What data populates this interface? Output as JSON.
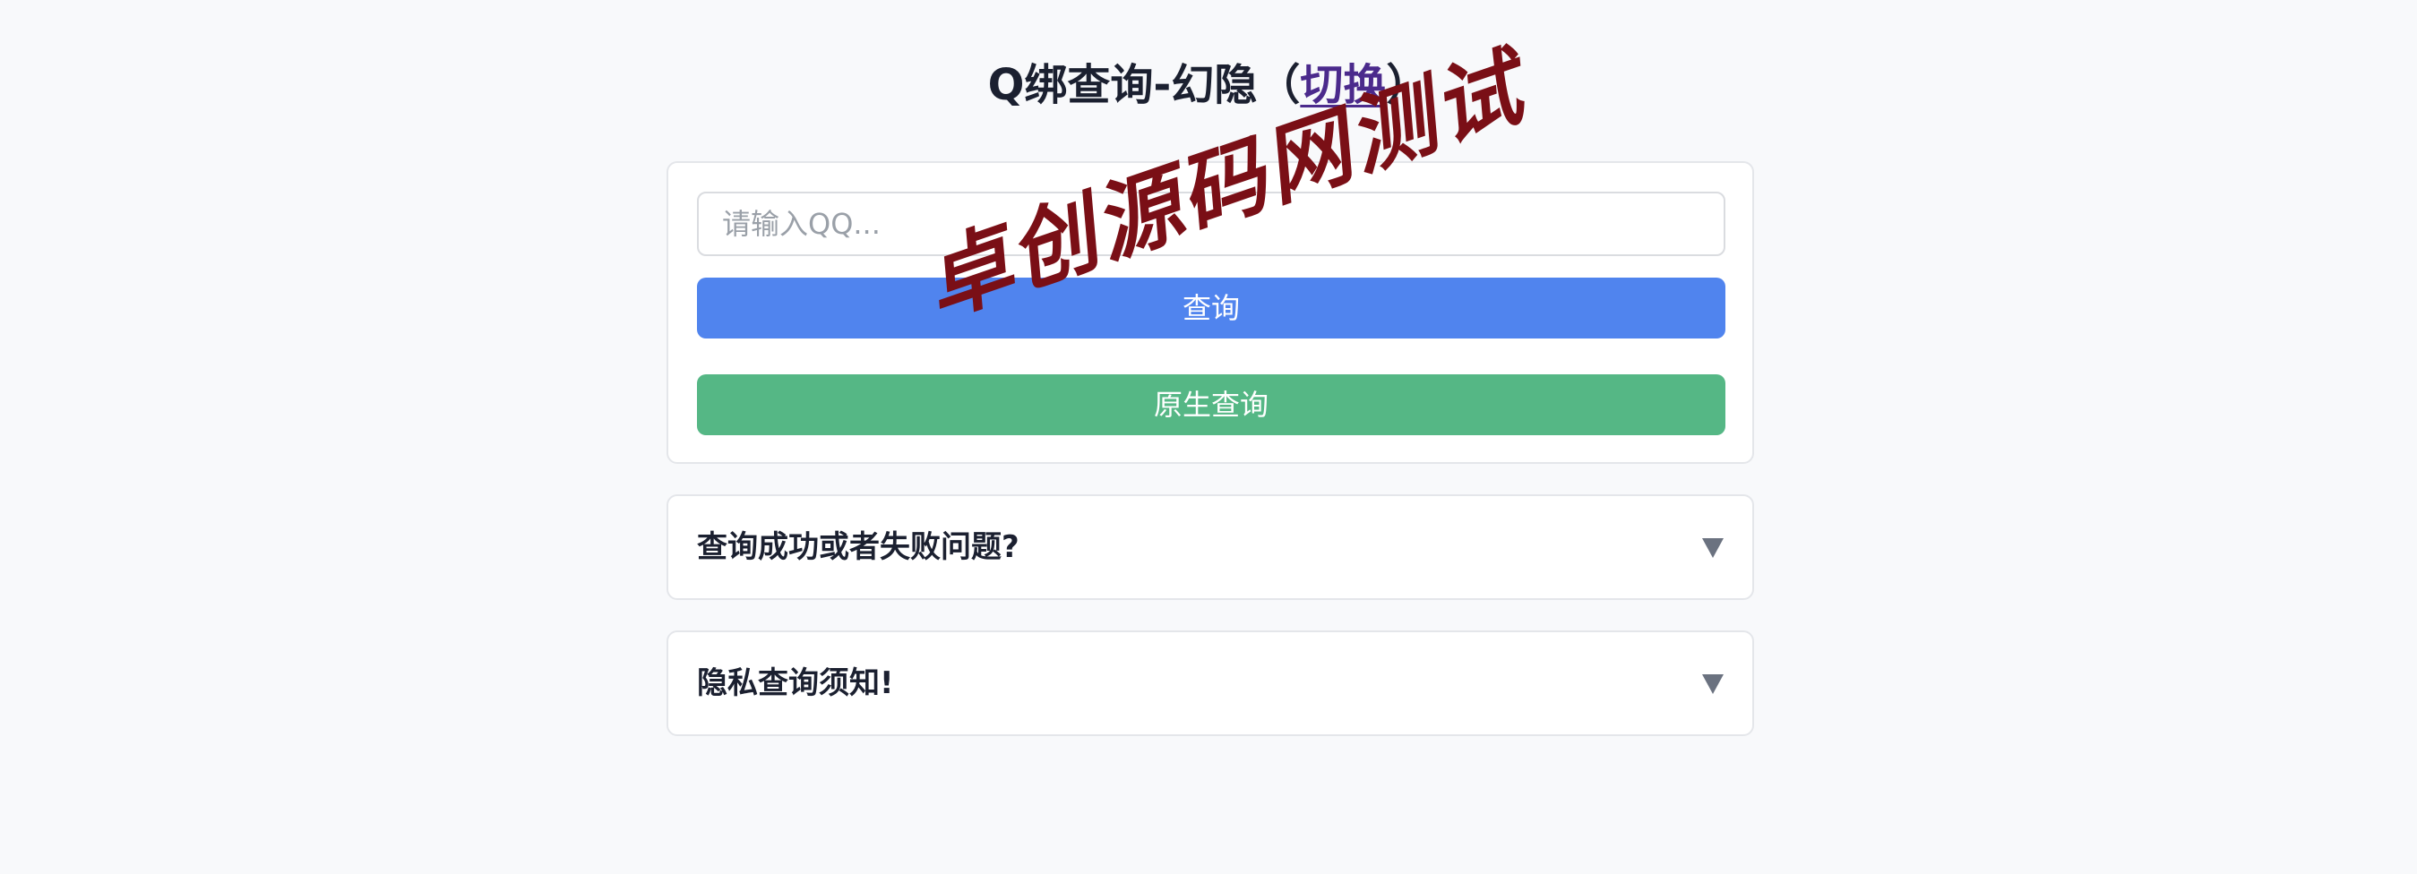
{
  "header": {
    "title_main": "Q绑查询-幻隐",
    "title_paren_open": "（",
    "switch_link": "切换",
    "title_paren_close": "）"
  },
  "search": {
    "placeholder": "请输入QQ...",
    "value": "",
    "query_button": "查询",
    "native_query_button": "原生查询"
  },
  "faq": [
    {
      "title": "查询成功或者失败问题?",
      "expanded": false
    },
    {
      "title": "隐私查询须知!",
      "expanded": false
    }
  ],
  "watermark": "卓创源码网测试",
  "colors": {
    "background": "#f8f9fb",
    "query_button": "#5084ee",
    "native_button": "#55b785",
    "link": "#4b2a8c",
    "watermark": "#7a0f16",
    "arrow": "#6b7280"
  },
  "icons": {
    "faq_toggle": "triangle-down-icon"
  }
}
